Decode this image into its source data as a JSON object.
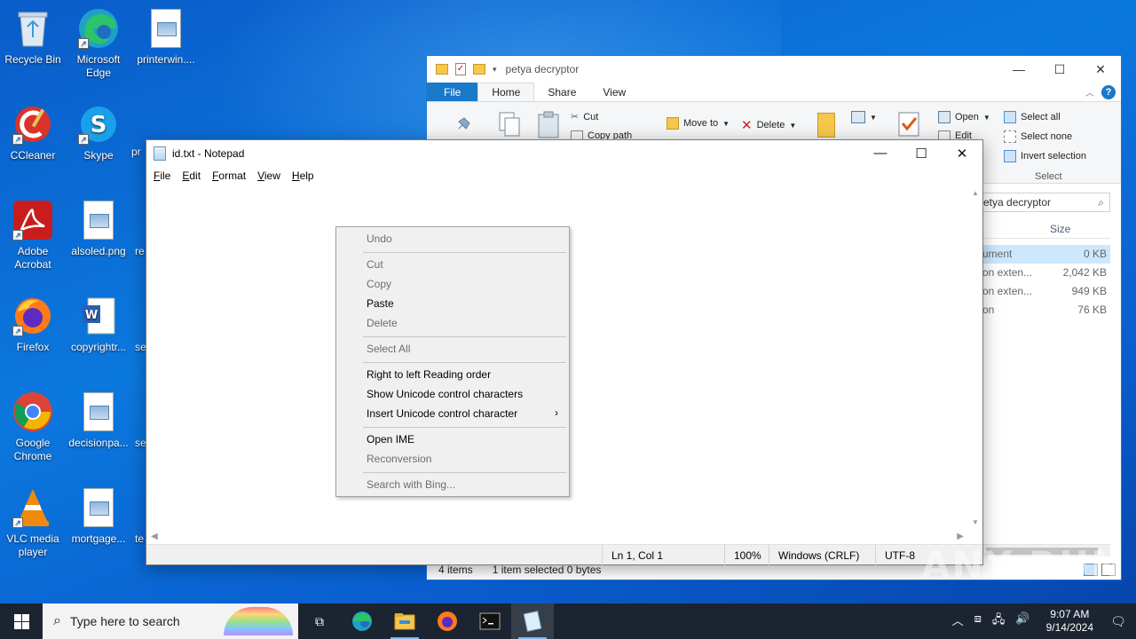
{
  "desktop": {
    "icons": [
      {
        "label": "Recycle Bin",
        "icon": "recycle-bin-icon"
      },
      {
        "label": "Microsoft Edge",
        "icon": "edge-icon"
      },
      {
        "label": "printerwin....",
        "icon": "image-file-icon"
      },
      {
        "label": "CCleaner",
        "icon": "ccleaner-icon"
      },
      {
        "label": "Skype",
        "icon": "skype-icon"
      },
      {
        "label": "pr",
        "icon": "word-file-icon"
      },
      {
        "label": "Adobe Acrobat",
        "icon": "acrobat-icon"
      },
      {
        "label": "alsoled.png",
        "icon": "image-file-icon"
      },
      {
        "label": "re",
        "icon": "file-icon"
      },
      {
        "label": "Firefox",
        "icon": "firefox-icon"
      },
      {
        "label": "copyrightr...",
        "icon": "word-file-icon"
      },
      {
        "label": "se",
        "icon": "file-icon"
      },
      {
        "label": "Google Chrome",
        "icon": "chrome-icon"
      },
      {
        "label": "decisionpa...",
        "icon": "image-file-icon"
      },
      {
        "label": "se",
        "icon": "file-icon"
      },
      {
        "label": "VLC media player",
        "icon": "vlc-icon"
      },
      {
        "label": "mortgage...",
        "icon": "image-file-icon"
      },
      {
        "label": "te",
        "icon": "file-icon"
      }
    ]
  },
  "explorer": {
    "title": "petya decryptor",
    "tabs": [
      "File",
      "Home",
      "Share",
      "View"
    ],
    "ribbon": {
      "cut": "Cut",
      "copy_path": "Copy path",
      "move_to": "Move to",
      "delete": "Delete",
      "open": "Open",
      "edit": "Edit",
      "select_all": "Select all",
      "select_none": "Select none",
      "invert_selection": "Invert selection",
      "select_group": "Select"
    },
    "search_text": "etya decryptor",
    "column_size": "Size",
    "rows": [
      {
        "name": "ument",
        "size": "0 KB",
        "selected": true
      },
      {
        "name": "on exten...",
        "size": "2,042 KB"
      },
      {
        "name": "on exten...",
        "size": "949 KB"
      },
      {
        "name": "on",
        "size": "76 KB"
      }
    ],
    "status": {
      "items": "4 items",
      "selected": "1 item selected  0 bytes"
    }
  },
  "notepad": {
    "title": "id.txt - Notepad",
    "menu": [
      "File",
      "Edit",
      "Format",
      "View",
      "Help"
    ],
    "status": {
      "position": "Ln 1, Col 1",
      "zoom": "100%",
      "line_endings": "Windows (CRLF)",
      "encoding": "UTF-8"
    }
  },
  "context_menu": {
    "undo": "Undo",
    "cut": "Cut",
    "copy": "Copy",
    "paste": "Paste",
    "delete": "Delete",
    "select_all": "Select All",
    "rtl": "Right to left Reading order",
    "show_unicode": "Show Unicode control characters",
    "insert_unicode": "Insert Unicode control character",
    "open_ime": "Open IME",
    "reconversion": "Reconversion",
    "search_bing": "Search with Bing..."
  },
  "watermark": "ANY RUN",
  "taskbar": {
    "search_placeholder": "Type here to search",
    "time": "9:07 AM",
    "date": "9/14/2024"
  },
  "colors": {
    "desktop": "#0b78de",
    "explorer_file_tab": "#1979ca",
    "taskbar": "#1b2430"
  }
}
